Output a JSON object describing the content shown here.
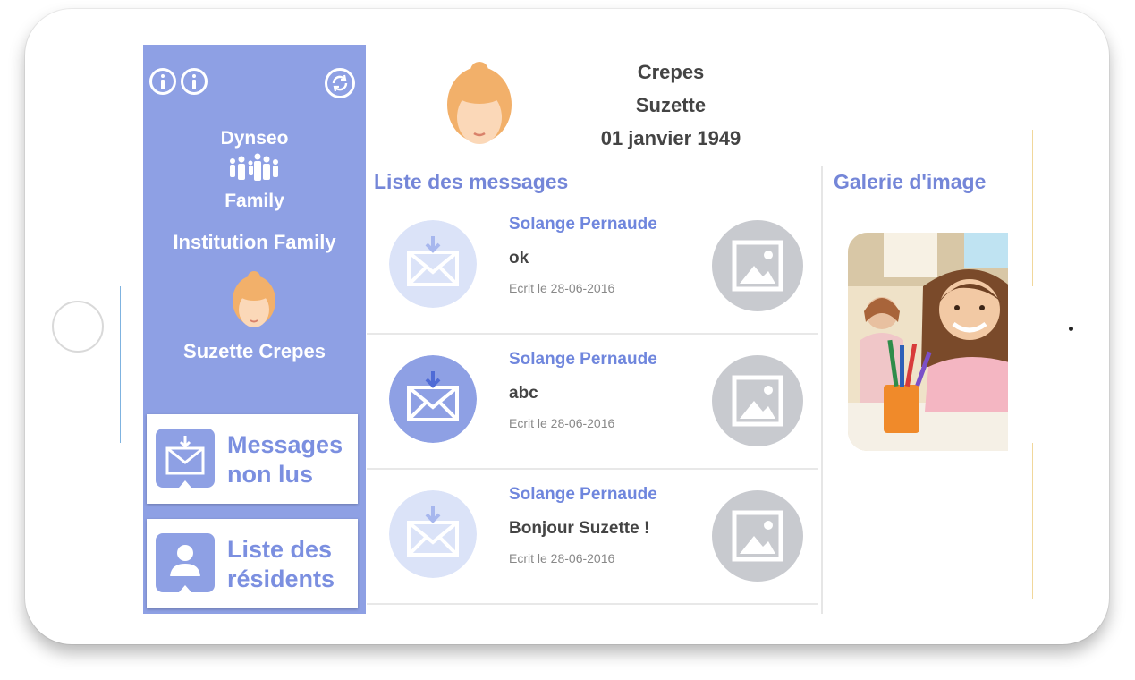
{
  "sidebar": {
    "brand_line1": "Dynseo",
    "brand_line2": "Family",
    "institution": "Institution Family",
    "resident_name": "Suzette Crepes",
    "cards": [
      {
        "label_line1": "Messages",
        "label_line2": "non lus",
        "icon": "envelope-icon"
      },
      {
        "label_line1": "Liste des",
        "label_line2": "résidents",
        "icon": "person-icon"
      }
    ]
  },
  "profile": {
    "last_name": "Crepes",
    "first_name": "Suzette",
    "birth_date": "01 janvier 1949"
  },
  "messages_section": {
    "title": "Liste des messages",
    "items": [
      {
        "author": "Solange Pernaude",
        "text": "ok",
        "date": "Ecrit le 28-06-2016",
        "read": true
      },
      {
        "author": "Solange Pernaude",
        "text": "abc",
        "date": "Ecrit le 28-06-2016",
        "read": false
      },
      {
        "author": "Solange Pernaude",
        "text": "Bonjour  Suzette !",
        "date": "Ecrit le 28-06-2016",
        "read": true
      }
    ]
  },
  "gallery_section": {
    "title": "Galerie d'image"
  },
  "colors": {
    "sidebar": "#8ea0e4",
    "accent_text": "#7486d8",
    "envelope_read": "#dbe3f8",
    "envelope_unread": "#8ea0e4",
    "image_button": "#c8cacf"
  }
}
